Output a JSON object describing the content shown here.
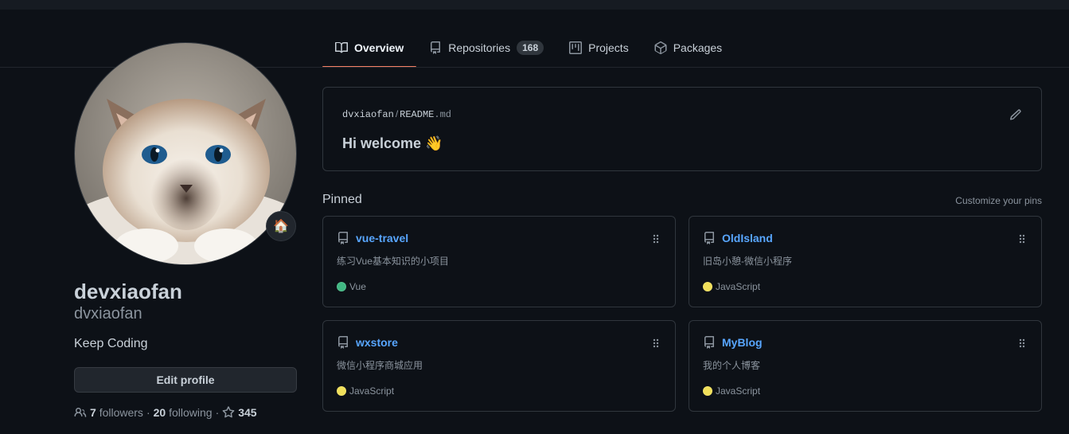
{
  "tabs": [
    {
      "label": "Overview",
      "active": true,
      "icon": "book-icon"
    },
    {
      "label": "Repositories",
      "count": "168",
      "icon": "repo-icon"
    },
    {
      "label": "Projects",
      "icon": "project-icon"
    },
    {
      "label": "Packages",
      "icon": "package-icon"
    }
  ],
  "profile": {
    "fullname": "devxiaofan",
    "login": "dvxiaofan",
    "bio": "Keep Coding",
    "status_emoji": "🏠",
    "edit_label": "Edit profile",
    "followers_count": "7",
    "followers_label": "followers",
    "following_count": "20",
    "following_label": "following",
    "stars_count": "345"
  },
  "readme": {
    "owner": "dvxiaofan",
    "file": "README",
    "ext": ".md",
    "text": "Hi welcome 👋"
  },
  "pinned": {
    "title": "Pinned",
    "customize_label": "Customize your pins",
    "repos": [
      {
        "name": "vue-travel",
        "description": "练习Vue基本知识的小项目",
        "language": "Vue",
        "language_color": "#41b883"
      },
      {
        "name": "OldIsland",
        "description": "旧岛小憩-微信小程序",
        "language": "JavaScript",
        "language_color": "#f1e05a"
      },
      {
        "name": "wxstore",
        "description": "微信小程序商城应用",
        "language": "JavaScript",
        "language_color": "#f1e05a"
      },
      {
        "name": "MyBlog",
        "description": "我的个人博客",
        "language": "JavaScript",
        "language_color": "#f1e05a"
      }
    ]
  },
  "colors": {
    "background": "#0d1117",
    "accent_tab": "#f78166",
    "link": "#58a6ff"
  }
}
